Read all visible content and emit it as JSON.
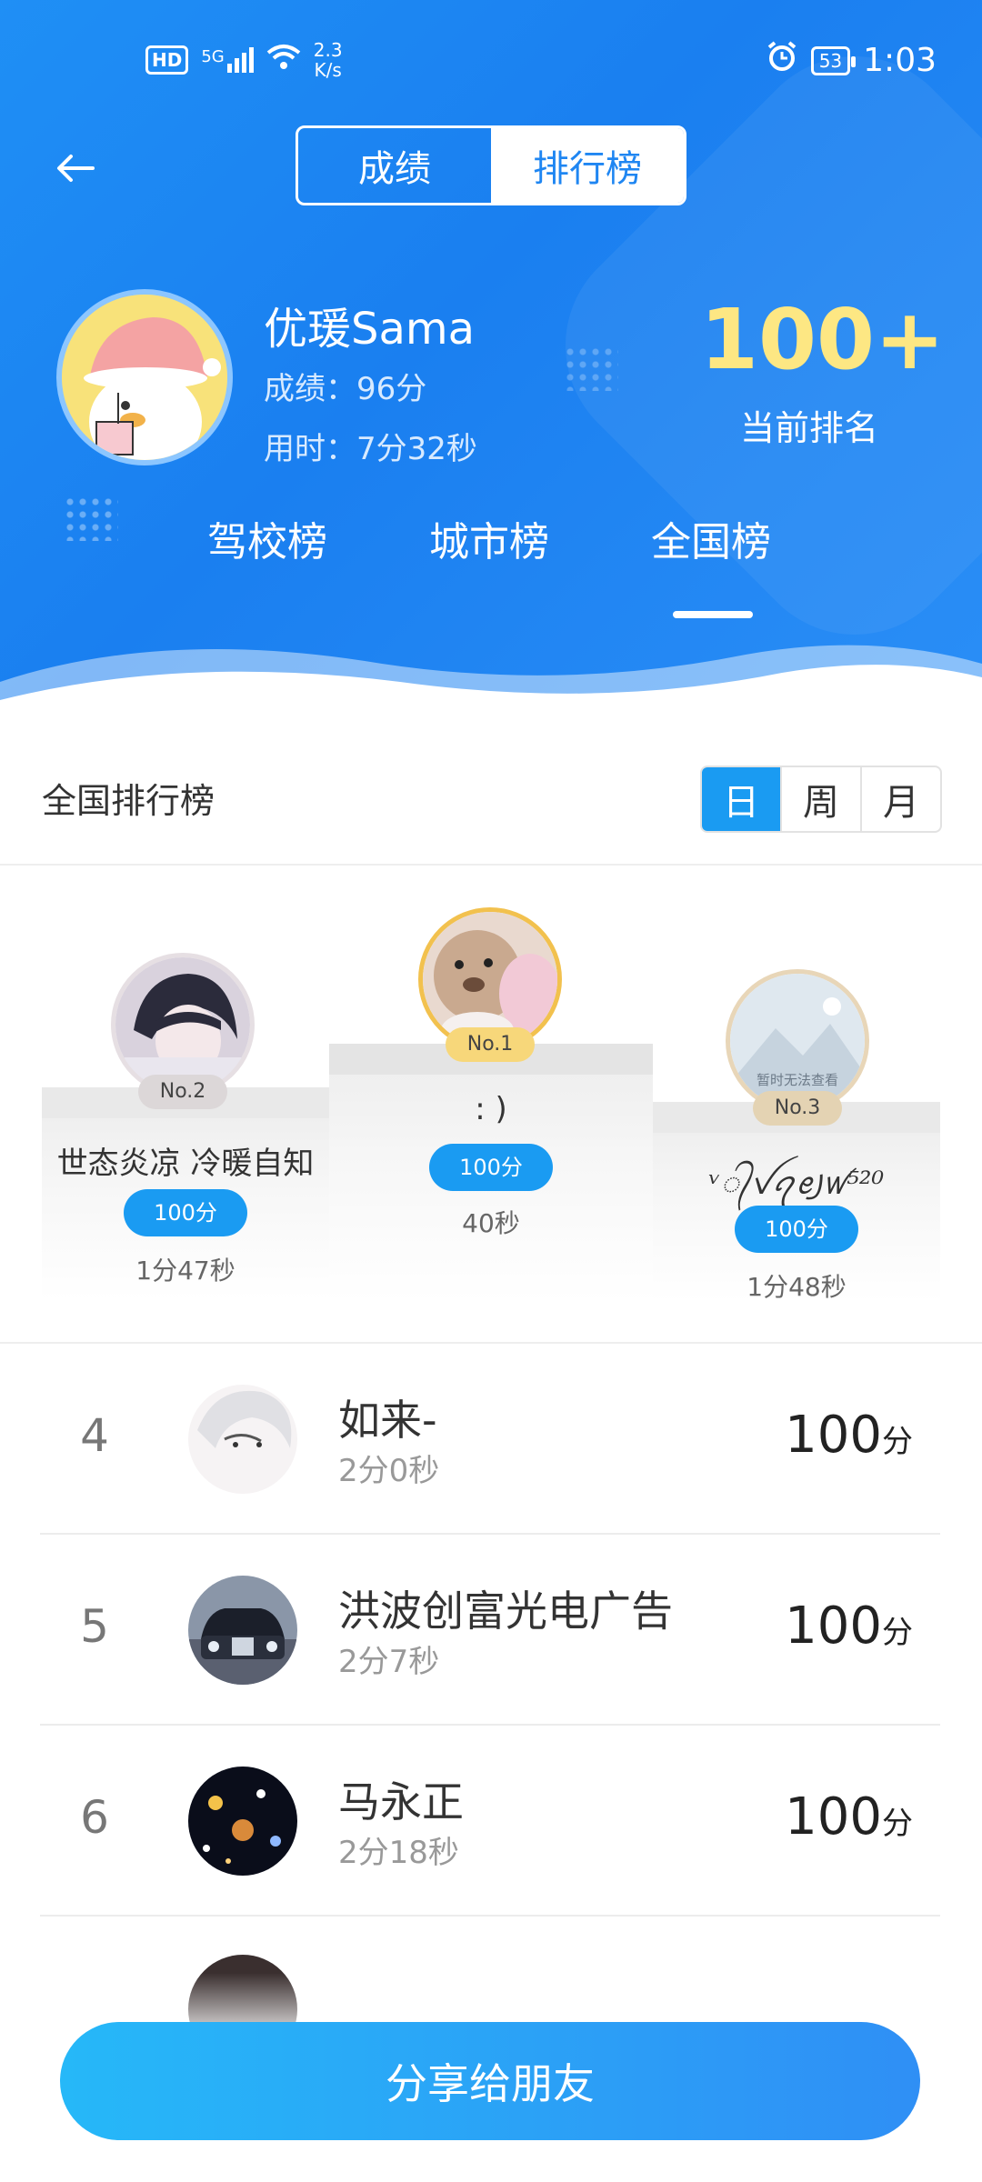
{
  "status_bar": {
    "hd": "HD",
    "signal": "5G",
    "speed_value": "2.3",
    "speed_unit": "K/s",
    "battery": "53",
    "time": "1:03"
  },
  "header": {
    "tabs": [
      "成绩",
      "排行榜"
    ],
    "active_tab": "排行榜"
  },
  "user": {
    "name": "优瑗Sama",
    "score": "成绩：96分",
    "time_used": "用时：7分32秒",
    "rank": "100+",
    "rank_label": "当前排名"
  },
  "scope_tabs": [
    "驾校榜",
    "城市榜",
    "全国榜"
  ],
  "active_scope": "全国榜",
  "section": {
    "title": "全国排行榜",
    "periods": [
      "日",
      "周",
      "月"
    ],
    "active_period": "日"
  },
  "podium": {
    "first": {
      "badge": "No.1",
      "name": ": )",
      "score": "100分",
      "time": "40秒"
    },
    "second": {
      "badge": "No.2",
      "name": "世态炎凉  冷暖自知",
      "score": "100分",
      "time": "1分47秒"
    },
    "third": {
      "badge": "No.3",
      "name": "ᵛ᭄ꪜꪖꫀ꠸ꪝ⁵²⁰",
      "score": "100分",
      "time": "1分48秒",
      "avatar_text": "暂时无法查看"
    }
  },
  "list": [
    {
      "rank": "4",
      "name": "如来-",
      "time": "2分0秒",
      "score": "100",
      "unit": "分"
    },
    {
      "rank": "5",
      "name": "洪波创富光电广告",
      "time": "2分7秒",
      "score": "100",
      "unit": "分"
    },
    {
      "rank": "6",
      "name": "马永正",
      "time": "2分18秒",
      "score": "100",
      "unit": "分"
    }
  ],
  "share_button": "分享给朋友",
  "colors": {
    "header_blue": "#1f86f2",
    "accent_blue": "#1a9bf2",
    "rank_yellow": "#fde783",
    "gold_badge": "#f2d58a"
  }
}
